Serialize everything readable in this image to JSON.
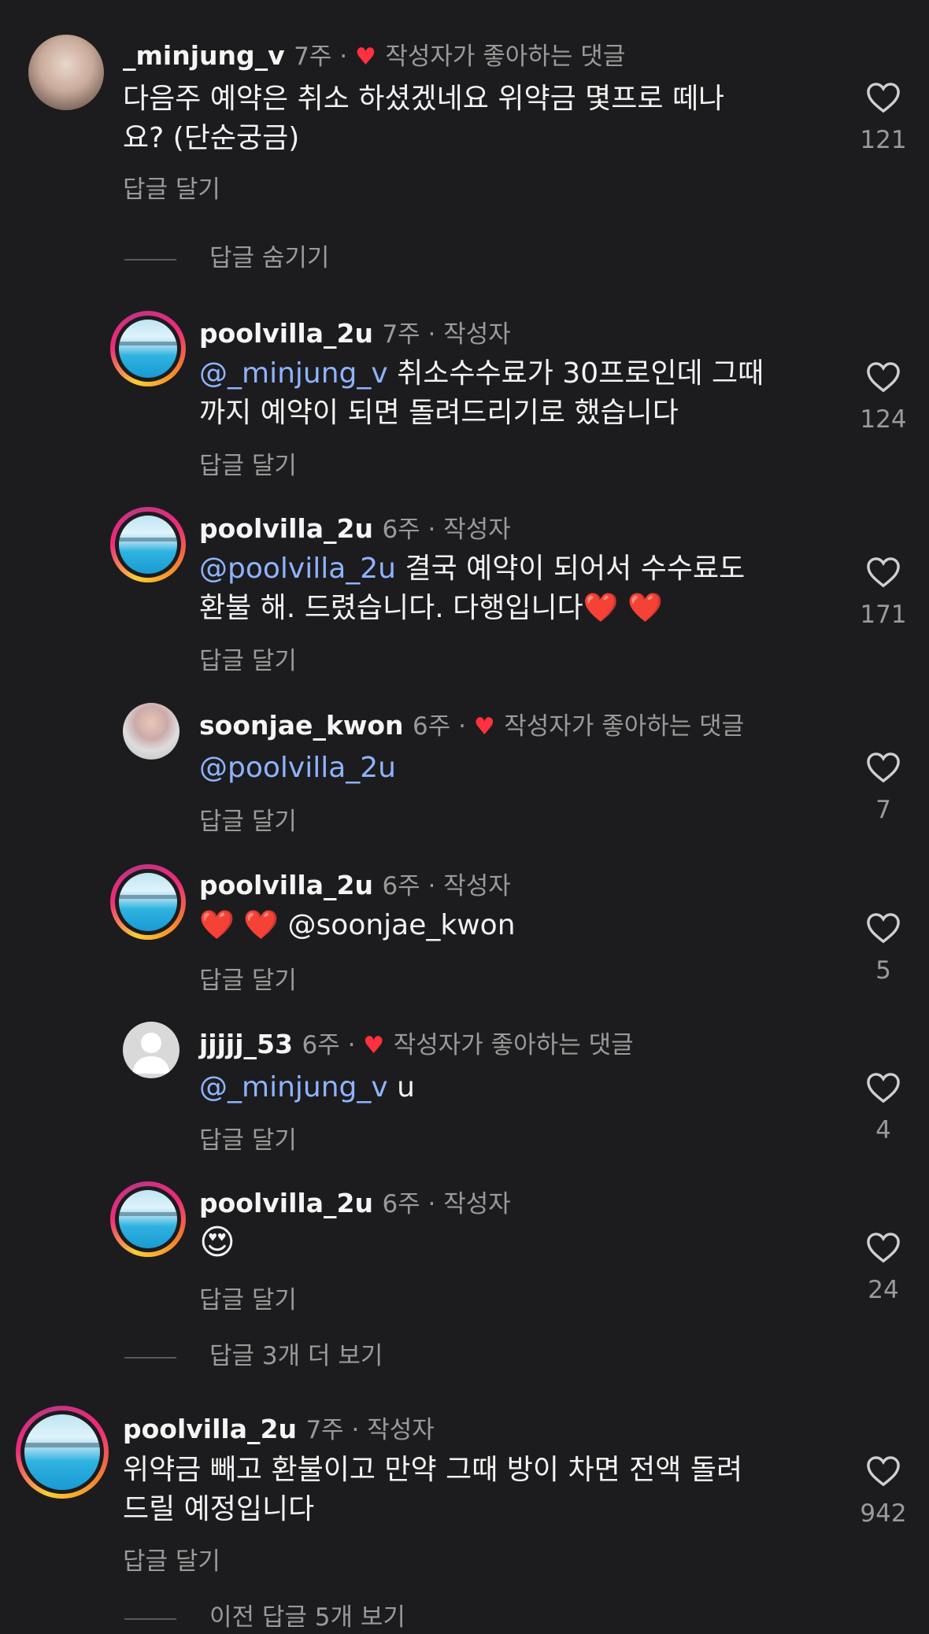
{
  "comments": [
    {
      "user": "_minjung_v",
      "time": "7주 · ",
      "liked_label": "작성자가 좋아하는 댓글",
      "line1": "다음주 예약은 취소 하셨겠네요 위약금 몇프로 떼나",
      "line2": "요? (단순궁금)",
      "reply": "답글 달기",
      "likes": "121"
    },
    {
      "user": "poolvilla_2u",
      "time": "7주 · 작성자",
      "mention": "@_minjung_v",
      "line1": " 취소수수료가 30프로인데 그때",
      "line2": "까지 예약이 되면 돌려드리기로 했습니다",
      "reply": "답글 달기",
      "likes": "124"
    },
    {
      "user": "poolvilla_2u",
      "time": "6주 · 작성자",
      "mention": "@poolvilla_2u",
      "line1": " 결국 예약이 되어서 수수료도",
      "line2": "환불 해. 드렸습니다. 다행입니다❤️ ❤️",
      "reply": "답글 달기",
      "likes": "171"
    },
    {
      "user": "soonjae_kwon",
      "time": "6주 · ",
      "liked_label": "작성자가 좋아하는 댓글",
      "mention": "@poolvilla_2u",
      "reply": "답글 달기",
      "likes": "7"
    },
    {
      "user": "poolvilla_2u",
      "time": "6주 · 작성자",
      "hearts": "❤️ ❤️ ",
      "text": "@soonjae_kwon",
      "reply": "답글 달기",
      "likes": "5"
    },
    {
      "user": "jjjjj_53",
      "time": "6주 · ",
      "liked_label": "작성자가 좋아하는 댓글",
      "mention": "@_minjung_v",
      "text": " u",
      "reply": "답글 달기",
      "likes": "4"
    },
    {
      "user": "poolvilla_2u",
      "time": "6주 · 작성자",
      "emoji": "😍",
      "reply": "답글 달기",
      "likes": "24"
    },
    {
      "user": "poolvilla_2u",
      "time": "7주 · 작성자",
      "line1": "위약금 빼고 환불이고 만약 그때 방이 차면 전액 돌려",
      "line2": "드릴 예정입니다",
      "reply": "답글 달기",
      "likes": "942"
    }
  ],
  "hide_replies": "답글 숨기기",
  "more_replies": "답글 3개 더 보기",
  "prev_replies": "이전 답글 5개 보기",
  "colors": {
    "background": "#1c1c1e",
    "mention": "#8fb3ff",
    "heart": "#ff3040"
  }
}
